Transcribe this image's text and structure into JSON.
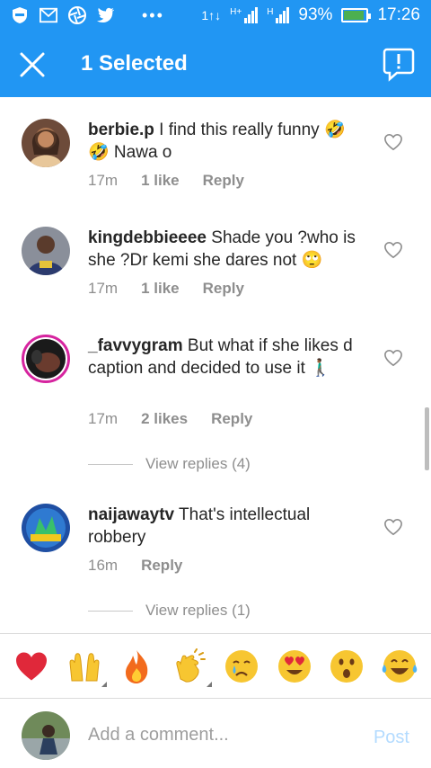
{
  "status_bar": {
    "signal_1": "1↑↓",
    "net_label_1": "H+",
    "net_label_2": "H",
    "battery": "93%",
    "battery_level": 0.93,
    "time": "17:26"
  },
  "app_bar": {
    "title": "1 Selected",
    "close_icon": "close-icon",
    "report_icon": "report-icon",
    "color": "#2196F3"
  },
  "comments": [
    {
      "username": "berbie.p",
      "text": " I find this really funny 🤣🤣 Nawa o",
      "time": "17m",
      "likes": "1 like",
      "reply": "Reply"
    },
    {
      "username": "kingdebbieeee",
      "text": " Shade you ?who is she ?Dr kemi she dares not 🙄",
      "time": "17m",
      "likes": "1 like",
      "reply": "Reply"
    },
    {
      "username": "_favvygram",
      "text": " But what if she likes d caption and decided to use it 🚶🏾‍♂️",
      "time": "17m",
      "likes": "2 likes",
      "reply": "Reply",
      "view_replies": "View replies (4)"
    },
    {
      "username": "naijawaytv",
      "text": " That's intellectual robbery",
      "time": "16m",
      "reply": "Reply",
      "view_replies": "View replies (1)"
    }
  ],
  "emoji_bar": [
    "❤️",
    "🙌",
    "🔥",
    "👏",
    "😢",
    "😍",
    "😮",
    "😂"
  ],
  "composer": {
    "placeholder": "Add a comment...",
    "post_label": "Post"
  }
}
